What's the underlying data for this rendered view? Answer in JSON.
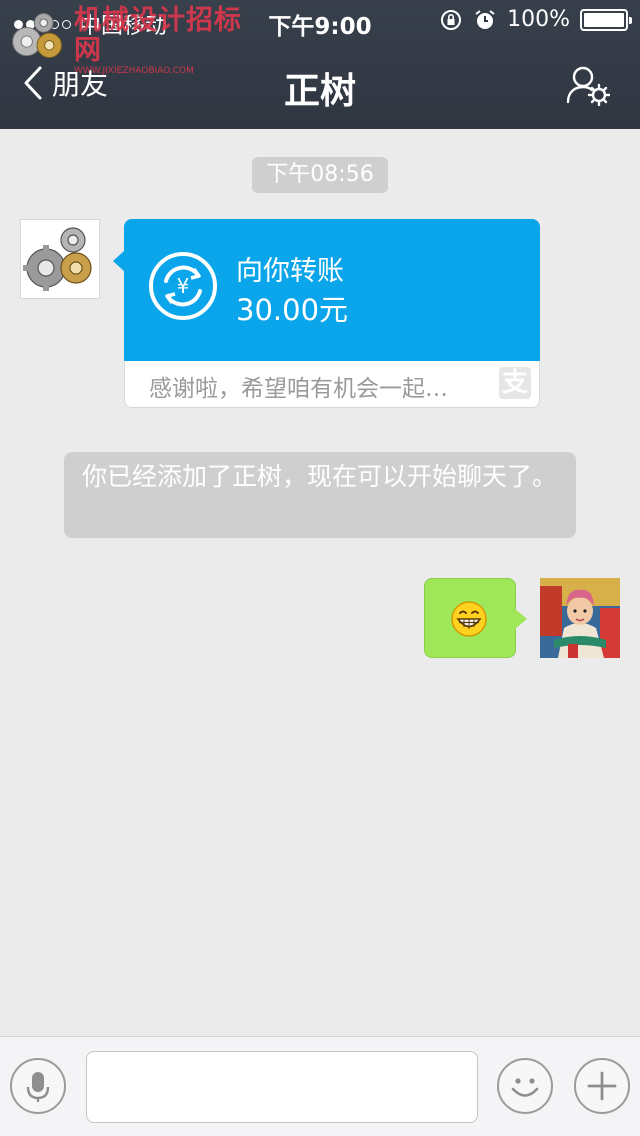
{
  "status_bar": {
    "carrier": "中国移动",
    "time": "下午9:00",
    "battery": "100%",
    "battery_level": 1.0
  },
  "watermark": {
    "text": "机械设计招标网",
    "url": "WWW.JIXIEZHAOBIAO.COM"
  },
  "nav": {
    "back_label": "朋友",
    "title": "正树"
  },
  "chat": {
    "timestamp": "下午08:56",
    "transfer": {
      "title": "向你转账",
      "amount": "30.00元",
      "note": "感谢啦，希望咱有机会一起…",
      "source_badge": "支"
    },
    "system_message": "你已经添加了正树，现在可以开始聊天了。",
    "sent_emoji": "grinning-face-icon"
  },
  "input": {
    "placeholder": ""
  },
  "colors": {
    "header": "#38404c",
    "transfer_blue": "#0aa5ea",
    "sent_bubble": "#9fe658",
    "background": "#ebebeb"
  }
}
